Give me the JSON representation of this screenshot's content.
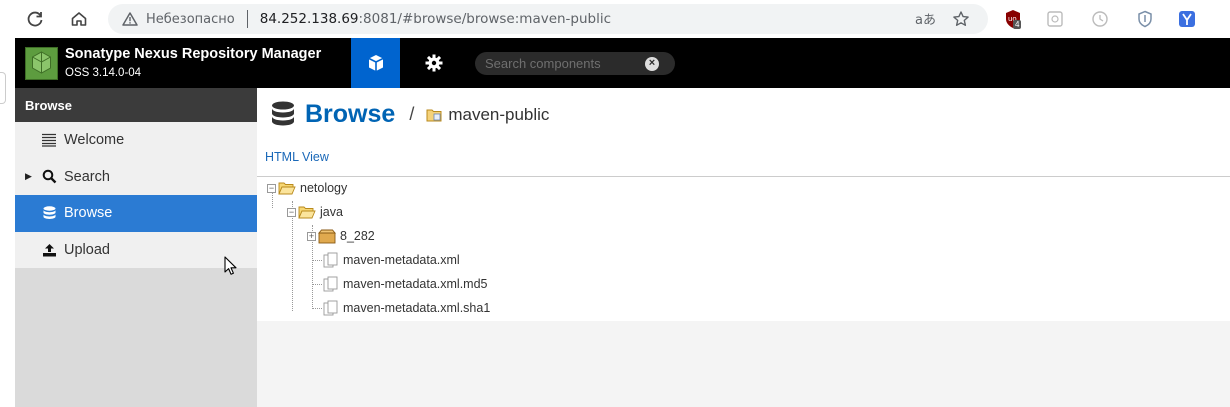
{
  "browser": {
    "security_label": "Небезопасно",
    "url_host": "84.252.138.69",
    "url_rest": ":8081/#browse/browse:maven-public",
    "translate_glyph": "aあ",
    "extension_badge": "4"
  },
  "header": {
    "brand_title": "Sonatype Nexus Repository Manager",
    "brand_version": "OSS 3.14.0-04",
    "search_placeholder": "Search components"
  },
  "sidebar": {
    "heading": "Browse",
    "items": [
      {
        "label": "Welcome",
        "icon": "list-icon"
      },
      {
        "label": "Search",
        "icon": "magnifier-icon"
      },
      {
        "label": "Browse",
        "icon": "database-icon",
        "active": true
      },
      {
        "label": "Upload",
        "icon": "upload-icon"
      }
    ]
  },
  "main": {
    "title": "Browse",
    "separator": "/",
    "breadcrumb": "maven-public",
    "html_view_link": "HTML View",
    "tree": [
      {
        "label": "netology",
        "type": "folder-open"
      },
      {
        "label": "java",
        "type": "folder-open"
      },
      {
        "label": "8_282",
        "type": "component"
      },
      {
        "label": "maven-metadata.xml",
        "type": "file"
      },
      {
        "label": "maven-metadata.xml.md5",
        "type": "file"
      },
      {
        "label": "maven-metadata.xml.sha1",
        "type": "file"
      }
    ]
  },
  "colors": {
    "accent_blue": "#0064cf",
    "sidebar_active": "#2b7bd3",
    "title_blue": "#0064b4",
    "header_bg": "#000000"
  }
}
